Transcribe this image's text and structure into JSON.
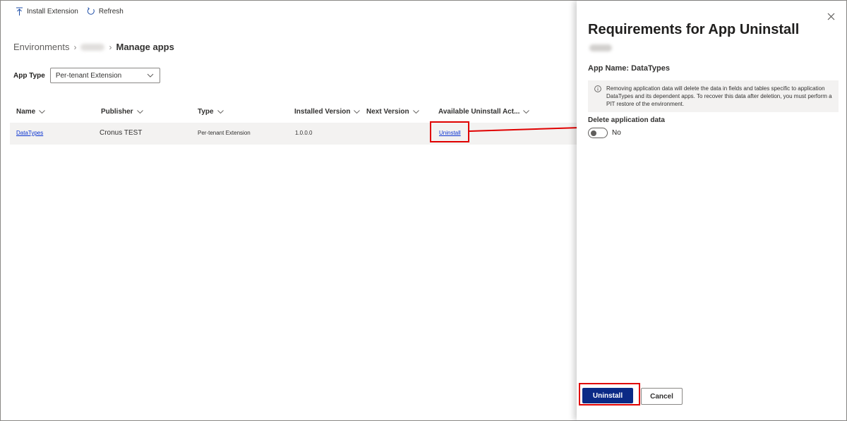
{
  "toolbar": {
    "install_label": "Install Extension",
    "install_icon": "upload-icon",
    "refresh_label": "Refresh",
    "refresh_icon": "refresh-icon"
  },
  "breadcrumb": {
    "root": "Environments",
    "current": "Manage apps"
  },
  "filter": {
    "label": "App Type",
    "selected": "Per-tenant Extension"
  },
  "table": {
    "columns": [
      "Name",
      "Publisher",
      "Type",
      "Installed Version",
      "Next Version",
      "Available Uninstall Act..."
    ],
    "rows": [
      {
        "name": "DataTypes",
        "publisher": "Cronus TEST",
        "type": "Per-tenant Extension",
        "installed_version": "1.0.0.0",
        "next_version": "",
        "action": "Uninstall"
      }
    ]
  },
  "panel": {
    "title": "Requirements for App Uninstall",
    "app_name": "App Name: DataTypes",
    "info_text": "Removing application data will delete the data in fields and tables specific to application DataTypes and its dependent apps. To recover this data after deletion, you must perform a PIT restore of the environment.",
    "delete_label": "Delete application data",
    "toggle_text": "No",
    "toggle_on": false,
    "uninstall_button": "Uninstall",
    "cancel_button": "Cancel"
  },
  "colors": {
    "primary": "#0b2a86",
    "highlight": "#e00000",
    "link": "#0b34d1"
  }
}
